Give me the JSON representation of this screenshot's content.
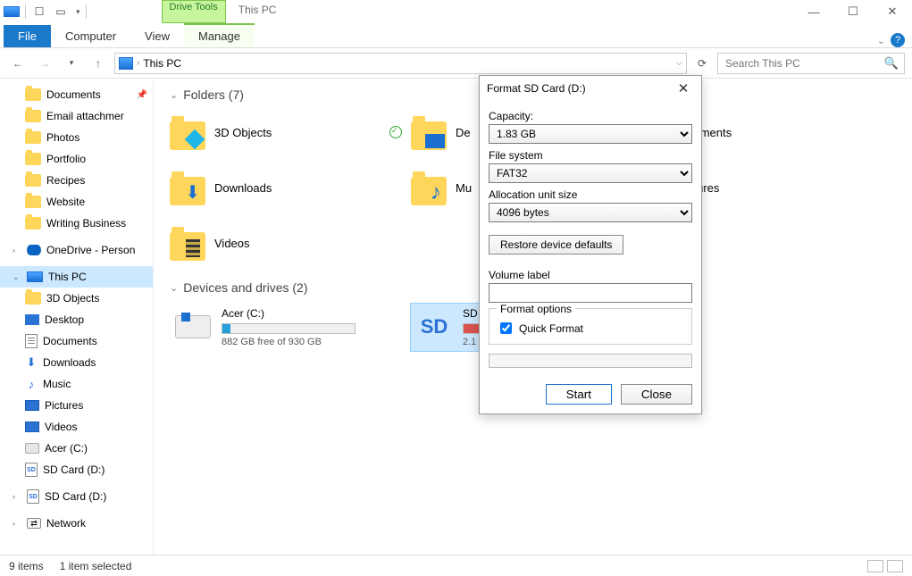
{
  "titlebar": {
    "context_tab": "Drive Tools",
    "title": "This PC"
  },
  "tabs": {
    "file": "File",
    "computer": "Computer",
    "view": "View",
    "manage": "Manage"
  },
  "nav": {
    "crumb": "This PC",
    "search_placeholder": "Search This PC"
  },
  "tree": {
    "quick": [
      {
        "label": "Documents"
      },
      {
        "label": "Email attachmer"
      },
      {
        "label": "Photos"
      },
      {
        "label": "Portfolio"
      },
      {
        "label": "Recipes"
      },
      {
        "label": "Website"
      },
      {
        "label": "Writing Business"
      }
    ],
    "onedrive": "OneDrive - Person",
    "thispc": "This PC",
    "pc": [
      {
        "label": "3D Objects"
      },
      {
        "label": "Desktop"
      },
      {
        "label": "Documents"
      },
      {
        "label": "Downloads"
      },
      {
        "label": "Music"
      },
      {
        "label": "Pictures"
      },
      {
        "label": "Videos"
      },
      {
        "label": "Acer (C:)"
      },
      {
        "label": "SD Card (D:)"
      }
    ],
    "sd": "SD Card (D:)",
    "network": "Network"
  },
  "sections": {
    "folders": "Folders (7)",
    "devices": "Devices and drives (2)"
  },
  "folders": [
    {
      "name": "3D Objects"
    },
    {
      "name": "De"
    },
    {
      "name": "Documents",
      "cut": "cuments"
    },
    {
      "name": "Downloads"
    },
    {
      "name": "Mu"
    },
    {
      "name": "Pictures",
      "cut": "ctures"
    },
    {
      "name": "Videos"
    }
  ],
  "drives": {
    "acer": {
      "name": "Acer (C:)",
      "free": "882 GB free of 930 GB",
      "fill_pct": 6
    },
    "sd": {
      "name": "SD",
      "fill_pct": 92,
      "sub": "2.1"
    }
  },
  "dialog": {
    "title": "Format SD Card (D:)",
    "capacity_label": "Capacity:",
    "capacity": "1.83 GB",
    "fs_label": "File system",
    "fs": "FAT32",
    "alloc_label": "Allocation unit size",
    "alloc": "4096 bytes",
    "restore": "Restore device defaults",
    "vol_label": "Volume label",
    "vol_value": "",
    "opts_legend": "Format options",
    "quick": "Quick Format",
    "start": "Start",
    "close": "Close"
  },
  "status": {
    "items": "9 items",
    "selected": "1 item selected"
  }
}
